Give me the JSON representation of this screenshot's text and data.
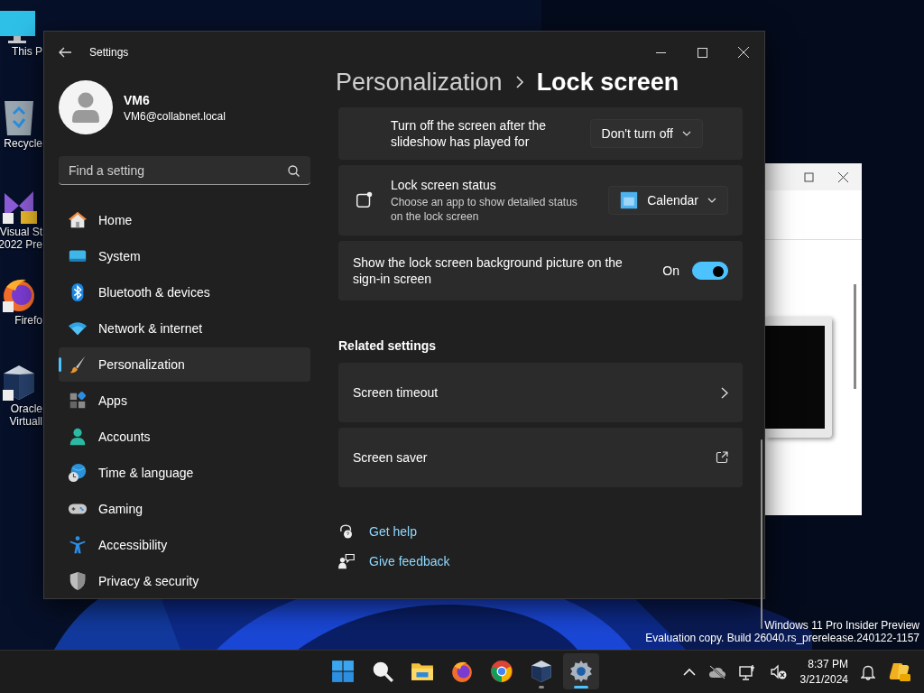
{
  "desktop": {
    "icons": [
      {
        "kind": "monitor",
        "lines": [
          "This P"
        ]
      },
      {
        "kind": "recycle",
        "lines": [
          "Recycle"
        ]
      },
      {
        "kind": "studio",
        "lines": [
          "Visual St",
          "2022 Pre"
        ]
      },
      {
        "kind": "firefox",
        "lines": [
          "Firefo"
        ]
      },
      {
        "kind": "virtualbox",
        "lines": [
          "Oracle",
          "Virtuall"
        ]
      }
    ]
  },
  "settings_window": {
    "title": "Settings",
    "user": {
      "name": "VM6",
      "email": "VM6@collabnet.local"
    },
    "search": {
      "placeholder": "Find a setting"
    },
    "nav": [
      {
        "kind": "home",
        "label": "Home",
        "selected": false
      },
      {
        "kind": "system",
        "label": "System",
        "selected": false
      },
      {
        "kind": "bluetooth",
        "label": "Bluetooth & devices",
        "selected": false
      },
      {
        "kind": "network",
        "label": "Network & internet",
        "selected": false
      },
      {
        "kind": "brush",
        "label": "Personalization",
        "selected": true
      },
      {
        "kind": "apps",
        "label": "Apps",
        "selected": false
      },
      {
        "kind": "accounts",
        "label": "Accounts",
        "selected": false
      },
      {
        "kind": "time",
        "label": "Time & language",
        "selected": false
      },
      {
        "kind": "gaming",
        "label": "Gaming",
        "selected": false
      },
      {
        "kind": "accessibility",
        "label": "Accessibility",
        "selected": false
      },
      {
        "kind": "privacy",
        "label": "Privacy & security",
        "selected": false
      }
    ],
    "breadcrumb": [
      "Personalization",
      "Lock screen"
    ],
    "rows": [
      {
        "kind": "dropdown",
        "title": "Turn off the screen after the slideshow has played for",
        "value": "Don't turn off"
      },
      {
        "kind": "app_dropdown",
        "title": "Lock screen status",
        "description": "Choose an app to show detailed status on the lock screen",
        "value": "Calendar"
      },
      {
        "kind": "toggle",
        "title": "Show the lock screen background picture on the sign-in screen",
        "state_label": "On",
        "on": true
      }
    ],
    "related": {
      "heading": "Related settings",
      "items": [
        {
          "kind": "chevron",
          "label": "Screen timeout"
        },
        {
          "kind": "external",
          "label": "Screen saver"
        }
      ]
    },
    "help_links": [
      {
        "kind": "help",
        "label": "Get help"
      },
      {
        "kind": "feedback",
        "label": "Give feedback"
      }
    ]
  },
  "build_notice": [
    "Windows 11 Pro Insider Preview",
    "Evaluation copy. Build 26040.rs_prerelease.240122-1157"
  ],
  "taskbar": {
    "apps": [
      {
        "kind": "start",
        "running": false,
        "active": false
      },
      {
        "kind": "search",
        "running": false,
        "active": false
      },
      {
        "kind": "explorer",
        "running": false,
        "active": false
      },
      {
        "kind": "firefox",
        "running": false,
        "active": false
      },
      {
        "kind": "chrome",
        "running": false,
        "active": false
      },
      {
        "kind": "virtualbox",
        "running": true,
        "active": false
      },
      {
        "kind": "settings",
        "running": true,
        "active": true
      }
    ],
    "time": "8:37 PM",
    "date": "3/21/2024"
  }
}
